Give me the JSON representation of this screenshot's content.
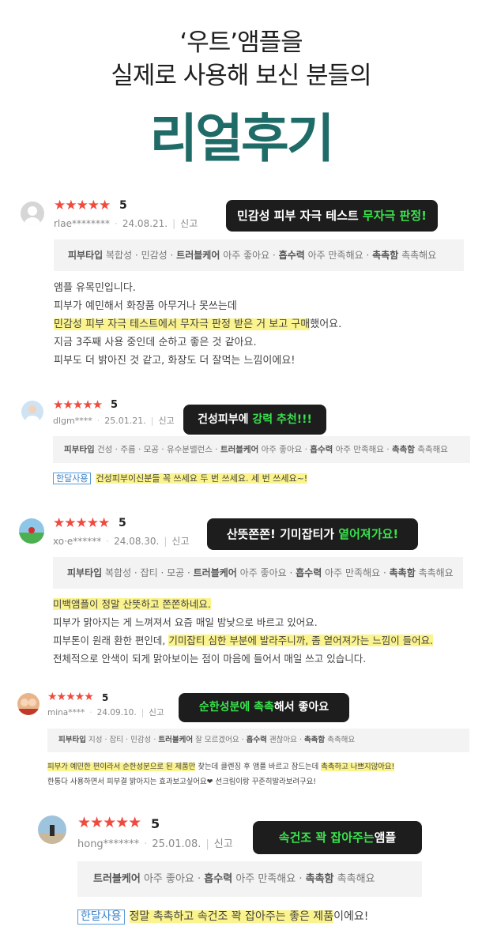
{
  "hero": {
    "line1": "‘우트’앰플을",
    "line2": "실제로 사용해 보신 분들의",
    "line3": "리얼후기"
  },
  "colors": {
    "brand": "#1f6b68",
    "star": "#f04a3f",
    "highlight": "#fbf38d",
    "callout_bg": "#1d1d1d",
    "callout_accent": "#38e34c"
  },
  "reviews": [
    {
      "stars": "★★★★★",
      "score": "5",
      "user": "rlae********",
      "date": "24.08.21.",
      "report": "신고",
      "callout_a": "민감성 피부 자극 테스트 ",
      "callout_b": "무자극 판정!",
      "bar_label1": "피부타입",
      "bar_val1": "복합성 · 민감성 ·",
      "bar_label2": "트러블케어",
      "bar_val2": "아주 좋아요 ·",
      "bar_label3": "흡수력",
      "bar_val3": "아주 만족해요 ·",
      "bar_label4": "촉촉함",
      "bar_val4": "촉촉해요",
      "text1": "앰플 유목민입니다.",
      "text2": "피부가 예민해서 화장품 아무거나 못쓰는데",
      "text3a": "민감성 피부 자극 테스트에서 무자극 판정 받은 거 보고 구매",
      "text3b": "했어요.",
      "text4": "지금 3주째 사용 중인데 순하고 좋은 것 같아요.",
      "text5": "피부도 더 밝아진 것 같고, 화장도 더 잘먹는 느낌이에요!"
    },
    {
      "stars": "★★★★★",
      "score": "5",
      "user": "dlgm****",
      "date": "25.01.21.",
      "report": "신고",
      "callout_a": "건성피부에 ",
      "callout_b": "강력 추천!!!",
      "bar_label1": "피부타입",
      "bar_val1": "건성 · 주름 · 모공 · 유수분밸런스 ·",
      "bar_label2": "트러블케어",
      "bar_val2": "아주 좋아요 ·",
      "bar_label3": "흡수력",
      "bar_val3": "아주 만족해요 ·",
      "bar_label4": "촉촉함",
      "bar_val4": "촉촉해요",
      "tag": "한달사용",
      "text1": "건성피부이신분들 꼭 쓰세요 두 번 쓰세요. 세 번 쓰세요~!"
    },
    {
      "stars": "★★★★★",
      "score": "5",
      "user": "xo·e******",
      "date": "24.08.30.",
      "report": "신고",
      "callout_a": "산뜻쫀쫀! 기미잡티가 ",
      "callout_b": "옅어져가요!",
      "bar_label1": "피부타입",
      "bar_val1": "복합성 · 잡티 · 모공 ·",
      "bar_label2": "트러블케어",
      "bar_val2": "아주 좋아요 ·",
      "bar_label3": "흡수력",
      "bar_val3": "아주 만족해요 ·",
      "bar_label4": "촉촉함",
      "bar_val4": "촉촉해요",
      "text1": "미백앰플이 정말 산뜻하고 쫀쫀하네요.",
      "text2": "피부가 맑아지는 게 느껴져서 요즘 매일 밤낮으로 바르고 있어요.",
      "text3a": "피부톤이 원래 환한 편인데, ",
      "text3b": "기미잡티 심한 부분에 발라주니까, 좀 옅어져가는 느낌이 들어요.",
      "text4": "전체적으로 안색이 되게 맑아보이는 점이 마음에 들어서 매일 쓰고 있습니다."
    },
    {
      "stars": "★★★★★",
      "score": "5",
      "user": "mina****",
      "date": "24.09.10.",
      "report": "신고",
      "callout_a": "순한성분에 촉촉",
      "callout_b": "해서 좋아요",
      "bar_label1": "피부타입",
      "bar_val1": "지성 · 잡티 · 민감성 ·",
      "bar_label2": "트러블케어",
      "bar_val2": "잘 모르겠어요 ·",
      "bar_label3": "흡수력",
      "bar_val3": "괜찮아요 ·",
      "bar_label4": "촉촉함",
      "bar_val4": "촉촉해요",
      "text1a": "피부가 예민한 편이라서 순한성분으로 된 제품만",
      "text1b": " 찾는데 클렌징 후 앰플 바르고 잠드는데 ",
      "text1c": "촉촉하고 나쁘지않아요!",
      "text2": "한통다 사용하면서 피부결 밝아지는 효과보고싶어요❤ 선크림이랑 꾸준히발라보려구요!"
    },
    {
      "stars": "★★★★★",
      "score": "5",
      "user": "hong*******",
      "date": "25.01.08.",
      "report": "신고",
      "callout_a": "속건조 꽉 잡아주는",
      "callout_b": "앰플",
      "bar_label2": "트러블케어",
      "bar_val2": "아주 좋아요 ·",
      "bar_label3": "흡수력",
      "bar_val3": "아주 만족해요 ·",
      "bar_label4": "촉촉함",
      "bar_val4": "촉촉해요",
      "tag": "한달사용",
      "text1a": "정말 촉촉하고 속건조 꽉 잡아주는 좋은 제품",
      "text1b": "이에요!"
    }
  ]
}
